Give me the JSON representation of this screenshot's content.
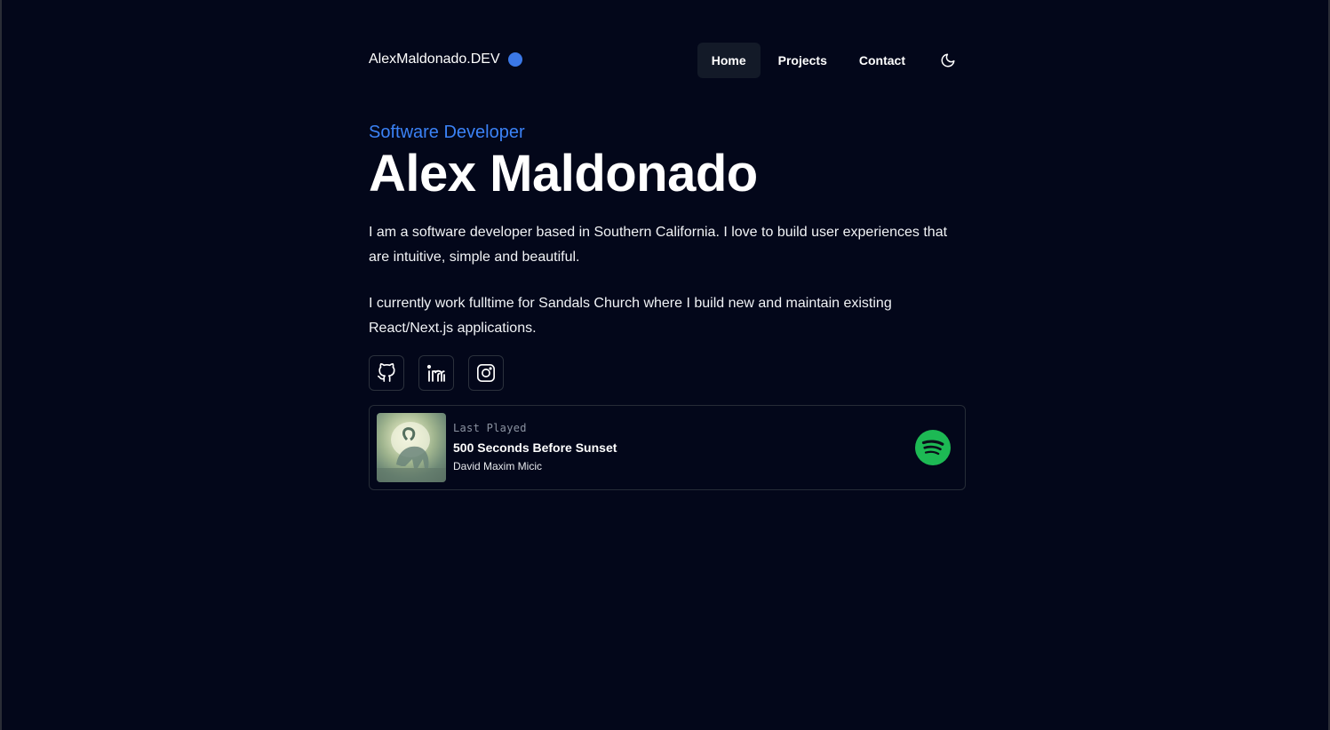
{
  "header": {
    "brand": "AlexMaldonado.DEV",
    "brand_dot_color": "#3b78e7",
    "nav": [
      {
        "label": "Home",
        "active": true
      },
      {
        "label": "Projects",
        "active": false
      },
      {
        "label": "Contact",
        "active": false
      }
    ],
    "theme_toggle_icon": "moon-icon"
  },
  "hero": {
    "subtitle": "Software Developer",
    "name": "Alex Maldonado",
    "bio": [
      "I am a software developer based in Southern California. I love to build user experiences that are intuitive, simple and beautiful.",
      "I currently work fulltime for Sandals Church where I build new and maintain existing React/Next.js applications."
    ]
  },
  "socials": [
    {
      "icon": "github-icon"
    },
    {
      "icon": "linkedin-icon"
    },
    {
      "icon": "instagram-icon"
    }
  ],
  "now_playing": {
    "label": "Last Played",
    "title": "500 Seconds Before Sunset",
    "artist": "David Maxim Micic",
    "service_icon": "spotify-icon",
    "service_color": "#1db954"
  },
  "colors": {
    "background": "#03071a",
    "accent": "#3b82f6"
  }
}
